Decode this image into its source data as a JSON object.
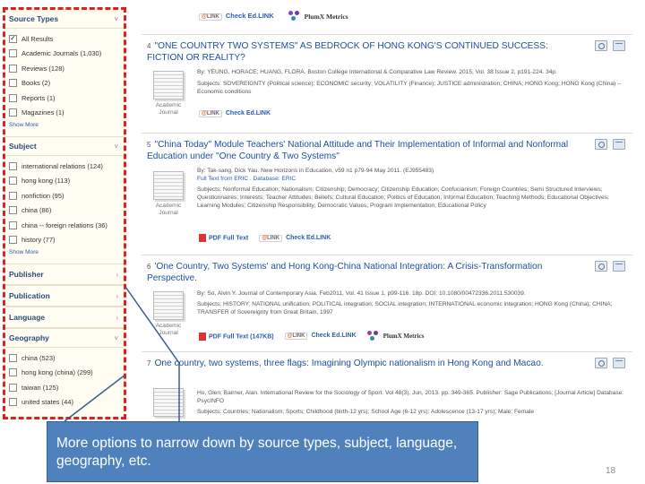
{
  "sidebar": {
    "facets": [
      {
        "title": "Source Types",
        "items": [
          {
            "label": "All Results",
            "checked": true
          },
          {
            "label": "Academic Journals (1,030)",
            "checked": false
          },
          {
            "label": "Reviews (128)",
            "checked": false
          },
          {
            "label": "Books (2)",
            "checked": false
          },
          {
            "label": "Reports (1)",
            "checked": false
          },
          {
            "label": "Magazines (1)",
            "checked": false
          }
        ],
        "show_more": "Show More"
      },
      {
        "title": "Subject",
        "items": [
          {
            "label": "international relations (124)",
            "checked": false
          },
          {
            "label": "hong kong (113)",
            "checked": false
          },
          {
            "label": "nonfiction (95)",
            "checked": false
          },
          {
            "label": "china (86)",
            "checked": false
          },
          {
            "label": "china -- foreign relations (36)",
            "checked": false
          },
          {
            "label": "history (77)",
            "checked": false
          }
        ],
        "show_more": "Show More"
      },
      {
        "title": "Publisher",
        "items": [],
        "show_more": ""
      },
      {
        "title": "Publication",
        "items": [],
        "show_more": ""
      },
      {
        "title": "Language",
        "items": [],
        "show_more": ""
      },
      {
        "title": "Geography",
        "items": [
          {
            "label": "china (523)",
            "checked": false
          },
          {
            "label": "hong kong (china) (299)",
            "checked": false
          },
          {
            "label": "taiwan (125)",
            "checked": false
          },
          {
            "label": "united states (44)",
            "checked": false
          }
        ],
        "show_more": ""
      }
    ]
  },
  "topbar": {
    "check_label": "Check Ed.LINK",
    "plumx_label": "PlumX Metrics"
  },
  "results": [
    {
      "number": "4",
      "title": "\"ONE COUNTRY TWO SYSTEMS\" AS BEDROCK OF HONG KONG'S CONTINUED SUCCESS: FICTION OR REALITY?",
      "thumb_label": "Academic Journal",
      "meta": [
        "By: YEUNG, HORACE; HUANG, FLORA. Boston College International & Comparative Law Review. 2015, Vol. 38 Issue 2, p191-224. 34p.",
        "Subjects: SOVEREIGNTY (Political science); ECONOMIC security; VOLATILITY (Finance); JUSTICE administration; CHINA; HONG Kong; HONG Kong (China) -- Economic conditions"
      ],
      "links": [
        "Check Ed.LINK"
      ]
    },
    {
      "number": "5",
      "title": "\"China Today\" Module Teachers' National Attitude and Their Implementation of Informal and Nonformal Education under \"One Country & Two Systems\"",
      "thumb_label": "Academic Journal",
      "meta": [
        "By: Tak-sang, Dick Yau. New Horizons in Education, v59 n1 p79-94 May 2011. (EJ955483)",
        "Full Text from ERIC . Database: ERIC",
        "Subjects: Nonformal Education; Nationalism; Citizenship; Democracy; Citizenship Education; Confucianism; Foreign Countries; Semi Structured Interviews; Questionnaires; Interests; Teacher Attitudes; Beliefs; Cultural Education; Politics of Education; Informal Education; Teaching Methods; Educational Objectives; Learning Modules; Citizenship Responsibility; Democratic Values; Program Implementation; Educational Policy"
      ],
      "links": [
        "PDF Full Text",
        "Check Ed.LINK"
      ]
    },
    {
      "number": "6",
      "title": "'One Country, Two Systems' and Hong Kong-China National Integration: A Crisis-Transformation Perspective.",
      "thumb_label": "Academic Journal",
      "meta": [
        "By: So, Alvin Y. Journal of Contemporary Asia. Feb2011, Vol. 41 Issue 1, p99-116. 18p. DOI: 10.1080/00472336.2011.530039.",
        "Subjects: HISTORY; NATIONAL unification; POLITICAL integration; SOCIAL integration; INTERNATIONAL economic integration; HONG Kong (China); CHINA; TRANSFER of Sovereignty from Great Britain, 1997"
      ],
      "links": [
        "PDF Full Text (147KB)",
        "Check Ed.LINK",
        "PlumX Metrics"
      ]
    },
    {
      "number": "7",
      "title": "One country, two systems, three flags: Imagining Olympic nationalism in Hong Kong and Macao.",
      "thumb_label": "Academic Journal",
      "meta": [
        "Ho, Glen; Bairner, Alan. International Review for the Sociology of Sport. Vol 48(3), Jun, 2013. pp. 349-365. Publisher: Sage Publications; [Journal Article] Database: PsycINFO",
        "Subjects: Countries; Nationalism; Sports; Childhood (birth-12 yrs); School Age (6-12 yrs); Adolescence (13-17 yrs); Male; Female"
      ],
      "links": []
    }
  ],
  "callout": {
    "text": "More options to narrow down by source types, subject, language, geography, etc."
  },
  "page_number": "18",
  "colors": {
    "accent_link": "#1f4fa0",
    "highlight_border": "#e02020",
    "callout_fill": "#4f81bd",
    "sidebar_bg": "#fffdf2"
  },
  "icons": [
    "checkbox-icon",
    "chevron-icon",
    "plumx-icon",
    "pdf-icon",
    "ebsco-link-icon",
    "preview-icon",
    "folder-icon"
  ]
}
